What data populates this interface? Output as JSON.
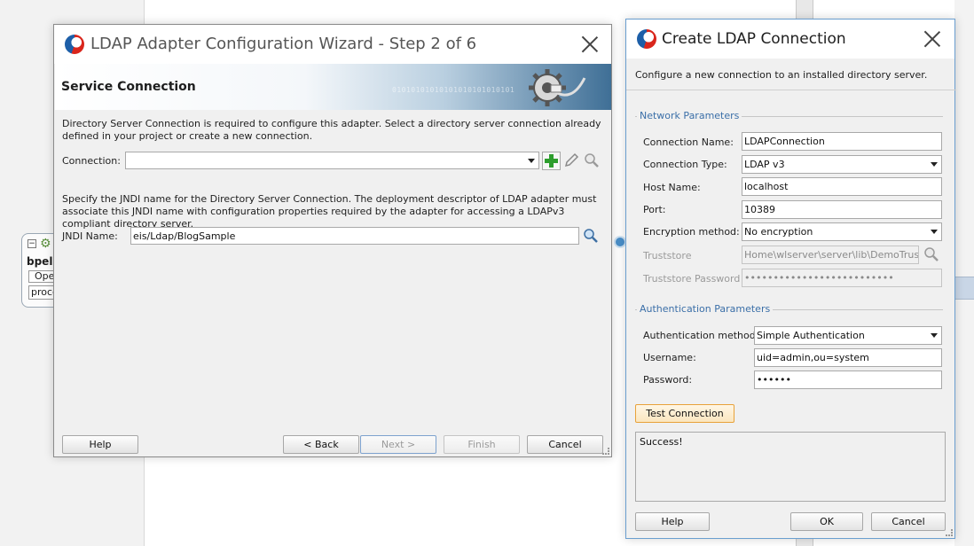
{
  "background": {
    "node_label": "bpelp",
    "node_box1": "Oper",
    "node_box2": "proce"
  },
  "wizard": {
    "title": "LDAP Adapter Configuration Wizard - Step 2 of 6",
    "banner_title": "Service Connection",
    "banner_bits": "01010101010101010101010101",
    "intro_text": "Directory Server Connection is required to configure this adapter. Select a directory server connection already defined in your project or create a new connection.",
    "connection_label": "Connection:",
    "connection_value": "",
    "jndi_text": "Specify the JNDI name for the Directory Server Connection. The deployment descriptor of LDAP adapter must associate this JNDI name with configuration properties required by the adapter for accessing a LDAPv3 compliant directory server.",
    "jndi_label": "JNDI Name:",
    "jndi_value": "eis/Ldap/BlogSample",
    "buttons": {
      "help": "Help",
      "back": "< Back",
      "next": "Next >",
      "finish": "Finish",
      "cancel": "Cancel"
    }
  },
  "ldap_dialog": {
    "title": "Create LDAP Connection",
    "subtitle": "Configure a new connection to an installed directory server.",
    "network_group": "Network Parameters",
    "fields": {
      "connection_name_label": "Connection Name:",
      "connection_name": "LDAPConnection",
      "connection_type_label": "Connection Type:",
      "connection_type": "LDAP v3",
      "host_name_label": "Host Name:",
      "host_name": "localhost",
      "port_label": "Port:",
      "port": "10389",
      "encryption_label": "Encryption method:",
      "encryption": "No encryption",
      "truststore_label": "Truststore",
      "truststore": "Home\\wlserver\\server\\lib\\DemoTrust.jks",
      "truststore_password_label": "Truststore Password",
      "truststore_password": "••••••••••••••••••••••••••"
    },
    "auth_group": "Authentication Parameters",
    "auth": {
      "method_label": "Authentication method:",
      "method": "Simple Authentication",
      "username_label": "Username:",
      "username": "uid=admin,ou=system",
      "password_label": "Password:",
      "password": "••••••"
    },
    "test_button": "Test Connection",
    "result": "Success!",
    "buttons": {
      "help": "Help",
      "ok": "OK",
      "cancel": "Cancel"
    }
  },
  "colors": {
    "accent": "#3b6fa8",
    "hot_button": "#e8a23a",
    "add_icon": "#2e9e2e"
  }
}
